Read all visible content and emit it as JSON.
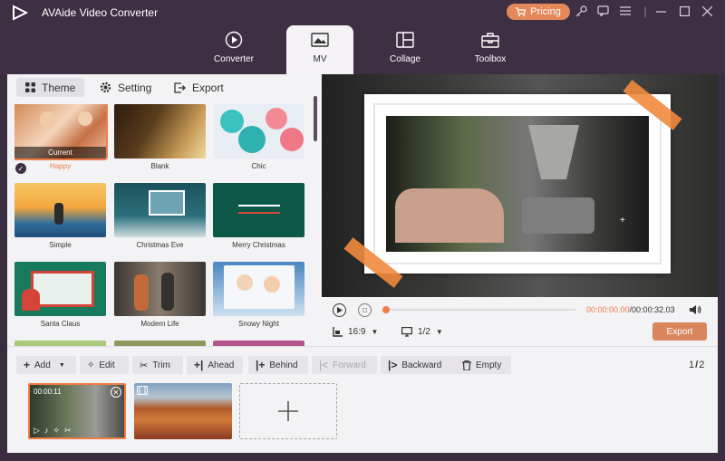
{
  "app": {
    "title": "AVAide Video Converter",
    "pricing_label": "Pricing"
  },
  "nav": [
    {
      "label": "Converter",
      "icon": "converter-icon"
    },
    {
      "label": "MV",
      "icon": "mv-icon"
    },
    {
      "label": "Collage",
      "icon": "collage-icon"
    },
    {
      "label": "Toolbox",
      "icon": "toolbox-icon"
    }
  ],
  "tabs": {
    "theme": "Theme",
    "setting": "Setting",
    "export": "Export"
  },
  "themes": [
    {
      "name": "Happy",
      "current_label": "Current",
      "selected": true,
      "colors": [
        "#c9794a",
        "#f1d3b8"
      ]
    },
    {
      "name": "Blank",
      "colors": [
        "#3a2612",
        "#c89a54"
      ]
    },
    {
      "name": "Chic",
      "colors": [
        "#2fb9b7",
        "#f07c8a"
      ]
    },
    {
      "name": "Simple",
      "colors": [
        "#f4b54a",
        "#2d6fa0"
      ]
    },
    {
      "name": "Christmas Eve",
      "colors": [
        "#1e5a63",
        "#c8d7dd"
      ]
    },
    {
      "name": "Merry Christmas",
      "colors": [
        "#0f5a4b",
        "#c9463f"
      ]
    },
    {
      "name": "Santa Claus",
      "colors": [
        "#177a5c",
        "#d5443a"
      ]
    },
    {
      "name": "Modern Life",
      "colors": [
        "#3d3a37",
        "#9a8f83"
      ]
    },
    {
      "name": "Snowy Night",
      "colors": [
        "#3e7bb8",
        "#e8eef5"
      ]
    }
  ],
  "player": {
    "current_time": "00:00:00.00",
    "total_time": "/00:00:32.03",
    "ratio": "16:9",
    "page": "1/2",
    "export_label": "Export"
  },
  "toolbar": {
    "add": "Add",
    "edit": "Edit",
    "trim": "Trim",
    "ahead": "Ahead",
    "behind": "Behind",
    "forward": "Forward",
    "backward": "Backward",
    "empty": "Empty",
    "page_current": "1",
    "page_sep": "/",
    "page_total": "2"
  },
  "clips": [
    {
      "time": "00:00:11"
    }
  ]
}
